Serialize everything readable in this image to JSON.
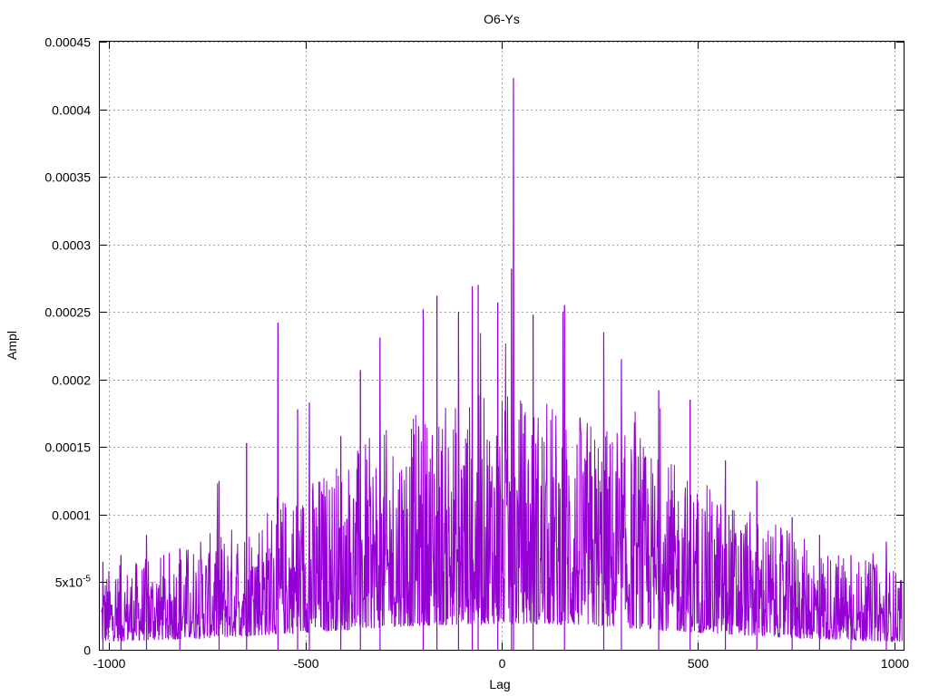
{
  "chart_data": {
    "type": "line",
    "title": "O6-Ys",
    "xlabel": "Lag",
    "ylabel": "Ampl",
    "xlim": [
      -1024,
      1024
    ],
    "ylim": [
      0,
      0.00045
    ],
    "grid": true,
    "legend": "none",
    "x_ticks": [
      {
        "value": -1000,
        "label": "-1000"
      },
      {
        "value": -500,
        "label": "-500"
      },
      {
        "value": 0,
        "label": "0"
      },
      {
        "value": 500,
        "label": "500"
      },
      {
        "value": 1000,
        "label": "1000"
      }
    ],
    "y_ticks": [
      {
        "value": 0,
        "label": "0"
      },
      {
        "value": 5e-05,
        "label": "5x10",
        "sup": "-5"
      },
      {
        "value": 0.0001,
        "label": "0.0001"
      },
      {
        "value": 0.00015,
        "label": "0.00015"
      },
      {
        "value": 0.0002,
        "label": "0.0002"
      },
      {
        "value": 0.00025,
        "label": "0.00025"
      },
      {
        "value": 0.0003,
        "label": "0.0003"
      },
      {
        "value": 0.00035,
        "label": "0.00035"
      },
      {
        "value": 0.0004,
        "label": "0.0004"
      },
      {
        "value": 0.00045,
        "label": "0.00045"
      }
    ],
    "line_color": "#9400d3",
    "series": [
      {
        "peaks": [
          {
            "x": -1016,
            "y": 6.5e-05
          },
          {
            "x": -970,
            "y": 7e-05
          },
          {
            "x": -905,
            "y": 8.5e-05
          },
          {
            "x": -820,
            "y": 7.5e-05
          },
          {
            "x": -720,
            "y": 0.000125
          },
          {
            "x": -650,
            "y": 0.000153
          },
          {
            "x": -570,
            "y": 0.000242
          },
          {
            "x": -520,
            "y": 0.000178
          },
          {
            "x": -490,
            "y": 0.000183
          },
          {
            "x": -410,
            "y": 0.000158
          },
          {
            "x": -360,
            "y": 0.000207
          },
          {
            "x": -310,
            "y": 0.000231
          },
          {
            "x": -200,
            "y": 0.000252
          },
          {
            "x": -165,
            "y": 0.000262
          },
          {
            "x": -110,
            "y": 0.00025
          },
          {
            "x": -75,
            "y": 0.000269
          },
          {
            "x": -60,
            "y": 0.00027
          },
          {
            "x": -10,
            "y": 0.000257
          },
          {
            "x": 25,
            "y": 0.000282
          },
          {
            "x": 30,
            "y": 0.000423
          },
          {
            "x": 80,
            "y": 0.000248
          },
          {
            "x": 160,
            "y": 0.000255
          },
          {
            "x": 260,
            "y": 0.000235
          },
          {
            "x": 305,
            "y": 0.000215
          },
          {
            "x": 400,
            "y": 0.000192
          },
          {
            "x": 480,
            "y": 0.000185
          },
          {
            "x": 570,
            "y": 0.00014
          },
          {
            "x": 650,
            "y": 0.000125
          },
          {
            "x": 740,
            "y": 9.8e-05
          },
          {
            "x": 810,
            "y": 8.5e-05
          },
          {
            "x": 890,
            "y": 7e-05
          },
          {
            "x": 980,
            "y": 8e-05
          }
        ]
      }
    ]
  }
}
